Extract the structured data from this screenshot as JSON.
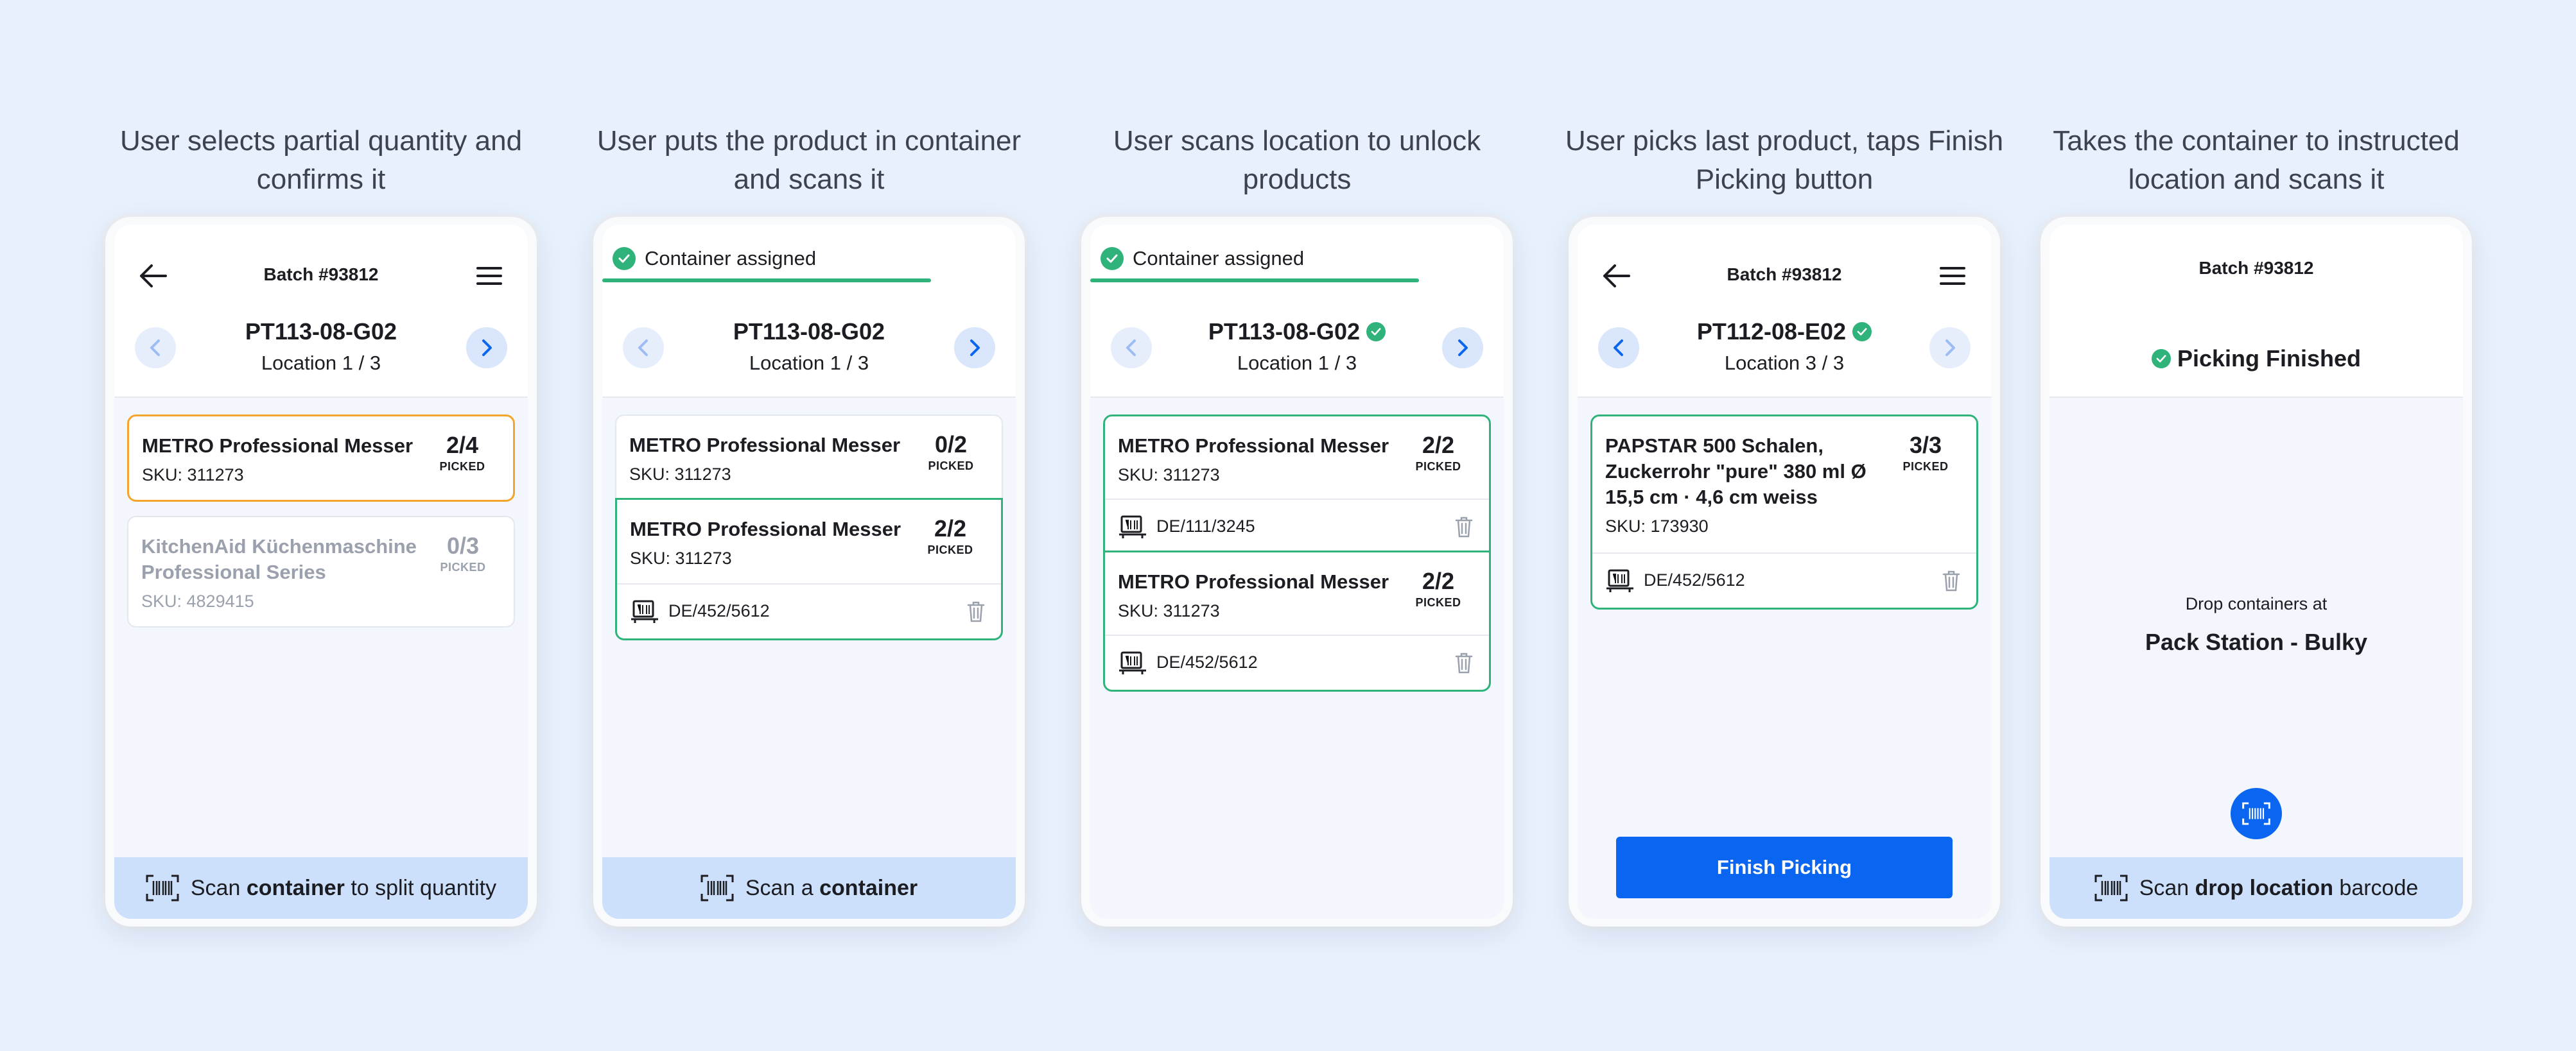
{
  "steps": [
    {
      "caption": "User selects partial quantity and confirms it",
      "batch": "Batch #93812",
      "location_code": "PT113-08-G02",
      "location_progress": "Location 1 / 3",
      "items": [
        {
          "name": "METRO Professional Messer",
          "sku": "SKU: 311273",
          "qty": "2/4",
          "qty_label": "PICKED"
        },
        {
          "name": "KitchenAid Küchenmaschine Professional Series",
          "sku": "SKU: 4829415",
          "qty": "0/3",
          "qty_label": "PICKED"
        }
      ],
      "bottom_pre": "Scan ",
      "bottom_bold": "container",
      "bottom_post": " to split quantity"
    },
    {
      "caption": "User puts the product in container and scans it",
      "assigned": "Container assigned",
      "location_code": "PT113-08-G02",
      "location_progress": "Location 1 / 3",
      "items": [
        {
          "name": "METRO Professional Messer",
          "sku": "SKU: 311273",
          "qty": "0/2",
          "qty_label": "PICKED"
        },
        {
          "name": "METRO Professional Messer",
          "sku": "SKU: 311273",
          "qty": "2/2",
          "qty_label": "PICKED",
          "container": "DE/452/5612"
        }
      ],
      "bottom_pre": "Scan a ",
      "bottom_bold": "container",
      "bottom_post": ""
    },
    {
      "caption": "User scans location to unlock products",
      "assigned": "Container assigned",
      "location_code": "PT113-08-G02",
      "location_progress": "Location 1 / 3",
      "items": [
        {
          "name": "METRO Professional Messer",
          "sku": "SKU: 311273",
          "qty": "2/2",
          "qty_label": "PICKED",
          "container": "DE/111/3245"
        },
        {
          "name": "METRO Professional Messer",
          "sku": "SKU: 311273",
          "qty": "2/2",
          "qty_label": "PICKED",
          "container": "DE/452/5612"
        }
      ]
    },
    {
      "caption": "User picks last product, taps Finish Picking button",
      "batch": "Batch #93812",
      "location_code": "PT112-08-E02",
      "location_progress": "Location 3 / 3",
      "items": [
        {
          "name": "PAPSTAR 500 Schalen, Zuckerrohr \"pure\" 380 ml Ø 15,5 cm · 4,6 cm weiss",
          "sku": "SKU: 173930",
          "qty": "3/3",
          "qty_label": "PICKED",
          "container": "DE/452/5612"
        }
      ],
      "finish_button": "Finish Picking"
    },
    {
      "caption": "Takes the container to instructed location and scans it",
      "batch": "Batch #93812",
      "finished": "Picking Finished",
      "drop_label": "Drop containers at",
      "drop_target": "Pack Station - Bulky",
      "bottom_pre": "Scan ",
      "bottom_bold": "drop location",
      "bottom_post": " barcode"
    }
  ],
  "colors": {
    "background": "#e7f0fc",
    "accent_blue": "#0a66f0",
    "success_green": "#2fb37a",
    "warning_orange": "#f3a52b",
    "scan_bar": "#cde0fb"
  },
  "icons": [
    "back-arrow-icon",
    "menu-icon",
    "chevron-left-icon",
    "chevron-right-icon",
    "check-circle-icon",
    "container-icon",
    "trash-icon",
    "barcode-scan-icon"
  ]
}
